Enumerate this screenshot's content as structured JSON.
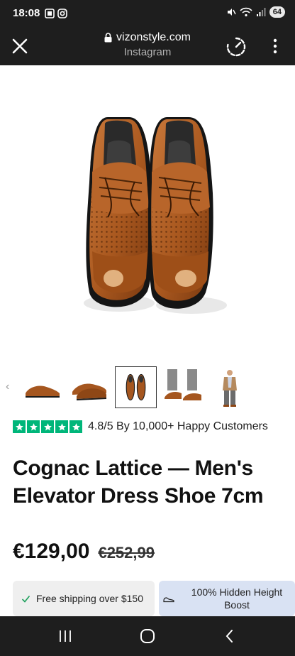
{
  "status_bar": {
    "time": "18:08",
    "battery": "64",
    "icons": [
      "screenshot-icon",
      "instagram-icon",
      "mute-icon",
      "wifi-icon",
      "signal-icon"
    ]
  },
  "browser": {
    "url": "vizonstyle.com",
    "source": "Instagram",
    "icons": [
      "close-icon",
      "lock-icon",
      "speed-icon",
      "more-vert-icon"
    ]
  },
  "gallery": {
    "hero_alt": "cognac-lattice-shoes-pair",
    "thumbnails": [
      "shoe-side",
      "shoe-pair-angle",
      "shoe-pair-top",
      "shoe-worn",
      "model-full"
    ],
    "selected_index": 2
  },
  "rating": {
    "stars": 5,
    "text": "4.8/5 By 10,000+ Happy Customers",
    "star_color": "#00b67a"
  },
  "product": {
    "title": "Cognac Lattice — Men's Elevator Dress Shoe 7cm",
    "price": "€129,00",
    "old_price": "€252,99"
  },
  "badges": {
    "shipping": "Free shipping over $150",
    "height": "100% Hidden Height Boost"
  },
  "nav": {
    "icons": [
      "recents-icon",
      "home-icon",
      "back-icon"
    ]
  }
}
